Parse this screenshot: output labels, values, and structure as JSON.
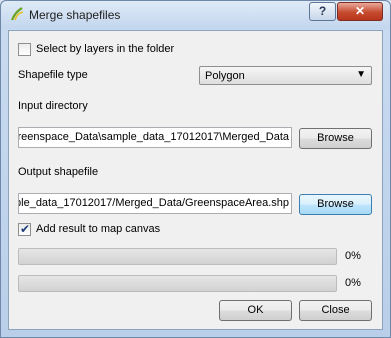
{
  "window": {
    "title": "Merge shapefiles",
    "help_label": "?",
    "close_label": "✕"
  },
  "select_by_layers": {
    "label": "Select by layers in the folder",
    "checked": false
  },
  "shapefile_type": {
    "label": "Shapefile type",
    "selected": "Polygon"
  },
  "input_directory": {
    "label": "Input directory",
    "value": "reenspace_Data\\sample_data_17012017\\Merged_Data",
    "browse_label": "Browse"
  },
  "output_shapefile": {
    "label": "Output shapefile",
    "value": "ple_data_17012017/Merged_Data/GreenspaceArea.shp",
    "browse_label": "Browse"
  },
  "add_to_canvas": {
    "label": "Add result to map canvas",
    "checked": true
  },
  "progress": [
    {
      "value": 0,
      "text": "0%"
    },
    {
      "value": 0,
      "text": "0%"
    }
  ],
  "buttons": {
    "ok": "OK",
    "close": "Close"
  },
  "icons": {
    "app": "qgis-icon",
    "checkmark": "checkmark-icon",
    "dropdown": "chevron-down-icon"
  },
  "colors": {
    "progress_fill": "#37b44a",
    "focus_border": "#3c7fb1"
  }
}
